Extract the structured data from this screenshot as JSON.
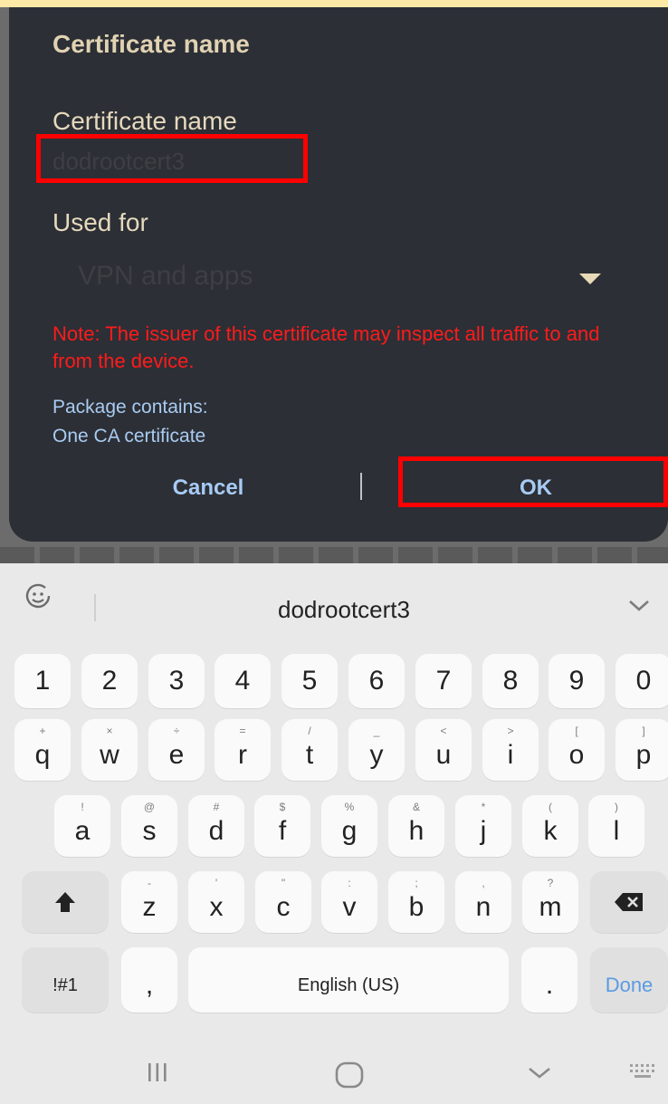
{
  "dialog": {
    "title": "Certificate name",
    "name_label": "Certificate name",
    "name_value": "dodrootcert3",
    "used_for_label": "Used for",
    "used_for_value": "VPN and apps",
    "note": "Note: The issuer of this certificate may inspect all traffic to and from the device.",
    "package_label": "Package contains:",
    "package_value": "One CA certificate",
    "cancel_label": "Cancel",
    "ok_label": "OK"
  },
  "keyboard": {
    "suggestion": "dodrootcert3",
    "number_row": [
      "1",
      "2",
      "3",
      "4",
      "5",
      "6",
      "7",
      "8",
      "9",
      "0"
    ],
    "row1": [
      {
        "k": "q",
        "s": "+"
      },
      {
        "k": "w",
        "s": "×"
      },
      {
        "k": "e",
        "s": "÷"
      },
      {
        "k": "r",
        "s": "="
      },
      {
        "k": "t",
        "s": "/"
      },
      {
        "k": "y",
        "s": "_"
      },
      {
        "k": "u",
        "s": "<"
      },
      {
        "k": "i",
        "s": ">"
      },
      {
        "k": "o",
        "s": "["
      },
      {
        "k": "p",
        "s": "]"
      }
    ],
    "row2": [
      {
        "k": "a",
        "s": "!"
      },
      {
        "k": "s",
        "s": "@"
      },
      {
        "k": "d",
        "s": "#"
      },
      {
        "k": "f",
        "s": "$"
      },
      {
        "k": "g",
        "s": "%"
      },
      {
        "k": "h",
        "s": "&"
      },
      {
        "k": "j",
        "s": "*"
      },
      {
        "k": "k",
        "s": "("
      },
      {
        "k": "l",
        "s": ")"
      }
    ],
    "row3": [
      {
        "k": "z",
        "s": "-"
      },
      {
        "k": "x",
        "s": "'"
      },
      {
        "k": "c",
        "s": "\""
      },
      {
        "k": "v",
        "s": ":"
      },
      {
        "k": "b",
        "s": ";"
      },
      {
        "k": "n",
        "s": ","
      },
      {
        "k": "m",
        "s": "?"
      }
    ],
    "symbols_label": "!#1",
    "comma_label": ",",
    "space_label": "English (US)",
    "period_label": ".",
    "done_label": "Done"
  },
  "icons": {
    "shift": "shift-icon",
    "backspace": "backspace-icon",
    "emoji": "emoji-icon",
    "collapse": "chevron-down-icon"
  }
}
